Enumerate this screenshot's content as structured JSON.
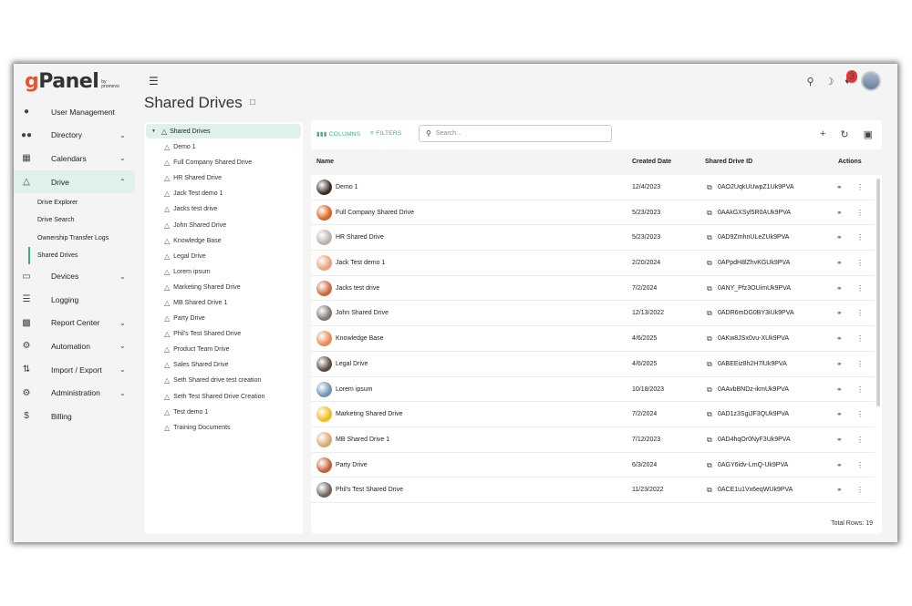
{
  "app": {
    "logo_g": "g",
    "logo_rest": "Panel",
    "logo_sub": "by promevo"
  },
  "colors": {
    "accent": "#37b28a",
    "active_bg": "#e0f1ea",
    "badge": "#e53935"
  },
  "sidebar": {
    "items": [
      {
        "label": "User Management",
        "icon": "person-icon",
        "chevron": false
      },
      {
        "label": "Directory",
        "icon": "people-icon",
        "chevron": true
      },
      {
        "label": "Calendars",
        "icon": "calendar-icon",
        "chevron": true
      },
      {
        "label": "Drive",
        "icon": "drive-icon",
        "chevron": true,
        "expanded": true
      },
      {
        "label": "Devices",
        "icon": "devices-icon",
        "chevron": true
      },
      {
        "label": "Logging",
        "icon": "list-icon",
        "chevron": false
      },
      {
        "label": "Report Center",
        "icon": "report-icon",
        "chevron": true
      },
      {
        "label": "Automation",
        "icon": "automation-icon",
        "chevron": true
      },
      {
        "label": "Import / Export",
        "icon": "import-export-icon",
        "chevron": true
      },
      {
        "label": "Administration",
        "icon": "admin-gear-icon",
        "chevron": true
      },
      {
        "label": "Billing",
        "icon": "dollar-icon",
        "chevron": false
      }
    ],
    "drive_sub": [
      "Drive Explorer",
      "Drive Search",
      "Ownership Transfer Logs",
      "Shared Drives"
    ]
  },
  "header": {
    "title": "Shared Drives",
    "notifications": "3"
  },
  "tree": {
    "root": "Shared Drives",
    "items": [
      "Demo 1",
      "Full Company Shared Drive",
      "HR Shared Drive",
      "Jack Test demo 1",
      "Jacks test drive",
      "John Shared Drive",
      "Knowledge Base",
      "Legal Drive",
      "Lorem ipsum",
      "Marketing Shared Drive",
      "MB Shared Drive 1",
      "Party Drive",
      "Phil's Test Shared Drive",
      "Product Team Drive",
      "Sales Shared Drive",
      "Seth Shared drive test creation",
      "Seth Test Shared Drive Creation",
      "Test demo 1",
      "Training Documents"
    ]
  },
  "grid": {
    "columns_btn": "COLUMNS",
    "filters_btn": "FILTERS",
    "search_placeholder": "Search...",
    "headers": {
      "name": "Name",
      "created": "Created Date",
      "id": "Shared Drive ID",
      "actions": "Actions"
    },
    "rows": [
      {
        "name": "Demo 1",
        "created": "12/4/2023",
        "id": "0AO2UqkUUwpZ1Uk9PVA",
        "thumb": "#3a2f28"
      },
      {
        "name": "Full Company Shared Drive",
        "created": "5/23/2023",
        "id": "0AAkGXSyl5R0AUk9PVA",
        "thumb": "#d9641e"
      },
      {
        "name": "HR Shared Drive",
        "created": "5/23/2023",
        "id": "0AD9ZmhnULeZUk9PVA",
        "thumb": "#b9b2ad"
      },
      {
        "name": "Jack Test demo 1",
        "created": "2/20/2024",
        "id": "0APpdH8lZhvKGUk9PVA",
        "thumb": "#e9a17a"
      },
      {
        "name": "Jacks test drive",
        "created": "7/2/2024",
        "id": "0ANY_Pfz3OUimUk9PVA",
        "thumb": "#c8683e"
      },
      {
        "name": "John Shared Drive",
        "created": "12/13/2022",
        "id": "0ADR6mDG0BY3iUk9PVA",
        "thumb": "#7d7873"
      },
      {
        "name": "Knowledge Base",
        "created": "4/6/2025",
        "id": "0AKw8JSx0vu-XUk9PVA",
        "thumb": "#e8894f"
      },
      {
        "name": "Legal Drive",
        "created": "4/6/2025",
        "id": "0ABEEiz8h2H7lUk9PVA",
        "thumb": "#5a4a3c"
      },
      {
        "name": "Lorem ipsum",
        "created": "10/18/2023",
        "id": "0AAvbBNDz-ikmUk9PVA",
        "thumb": "#6f93b5"
      },
      {
        "name": "Marketing Shared Drive",
        "created": "7/2/2024",
        "id": "0AD1z3SgiJF3QUk9PVA",
        "thumb": "#f0b91d"
      },
      {
        "name": "MB Shared Drive 1",
        "created": "7/12/2023",
        "id": "0AD4hqOr0NyF3Uk9PVA",
        "thumb": "#d8a874"
      },
      {
        "name": "Party Drive",
        "created": "6/3/2024",
        "id": "0AGY6idv-LmQ-Uk9PVA",
        "thumb": "#c4603a"
      },
      {
        "name": "Phil's Test Shared Drive",
        "created": "11/23/2022",
        "id": "0ACE1u1Vx6eqWUk9PVA",
        "thumb": "#6e635b"
      }
    ],
    "total_rows": "Total Rows: 19"
  }
}
